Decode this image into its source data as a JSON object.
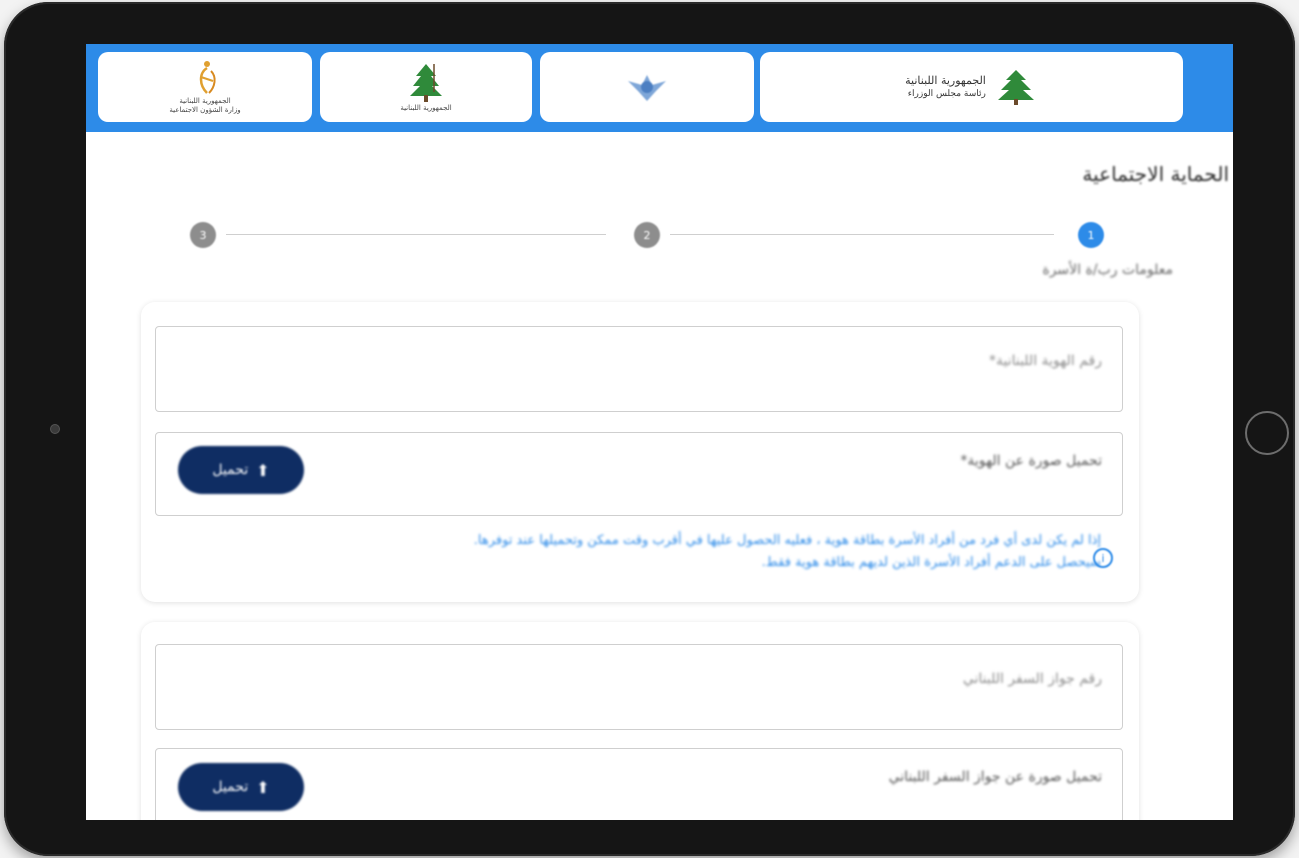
{
  "app": {
    "title": "الحماية الاجتماعية"
  },
  "header": {
    "logos": [
      {
        "name": "ministry-social-affairs",
        "lines": [
          "الجمهورية اللبنانية",
          "وزارة الشؤون الاجتماعية"
        ]
      },
      {
        "name": "lebanese-republic-cedar-logo",
        "lines": [
          "الجمهورية اللبنانية"
        ]
      },
      {
        "name": "lebanese-army-logo",
        "lines": []
      },
      {
        "name": "presidency-council-ministers",
        "lines": [
          "الجمهورية اللبنانية",
          "رئاسة مجلس الوزراء"
        ]
      }
    ]
  },
  "stepper": {
    "steps": [
      "3",
      "2",
      "1"
    ],
    "active_label": "معلومات رب/ة الأسرة"
  },
  "form": {
    "id_number_placeholder": "رقم الهوية اللبنانية*",
    "id_upload_label": "تحميل صورة عن الهوية*",
    "upload_button_label": "تحميل",
    "notice_line1": "إذا لم يكن لدى أي فرد من أفراد الأسرة بطاقة هوية ، فعليه الحصول عليها في أقرب وقت ممكن وتحميلها عند توفرها.",
    "notice_line2": "سيحصل على الدعم أفراد الأسرة الذين لديهم بطاقة هوية فقط.",
    "passport_placeholder": "رقم جواز السفر اللبناني",
    "passport_upload_label": "تحميل صورة عن جواز السفر اللبناني"
  },
  "colors": {
    "header_blue": "#2d8be8",
    "button_navy": "#0f2d63",
    "step_inactive": "#8d8d8d"
  },
  "icons": {
    "upload": "upload-arrow-icon",
    "info": "info-circle-icon"
  }
}
